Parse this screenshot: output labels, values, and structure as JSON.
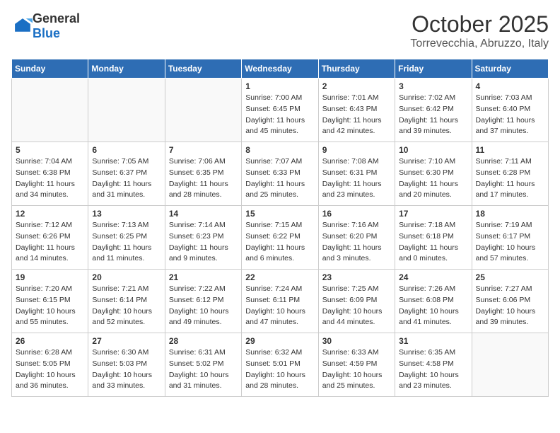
{
  "header": {
    "logo": {
      "general": "General",
      "blue": "Blue",
      "tagline": ""
    },
    "month": "October 2025",
    "location": "Torrevecchia, Abruzzo, Italy"
  },
  "days_of_week": [
    "Sunday",
    "Monday",
    "Tuesday",
    "Wednesday",
    "Thursday",
    "Friday",
    "Saturday"
  ],
  "weeks": [
    [
      {
        "day": "",
        "info": "",
        "empty": true
      },
      {
        "day": "",
        "info": "",
        "empty": true
      },
      {
        "day": "",
        "info": "",
        "empty": true
      },
      {
        "day": "1",
        "info": "Sunrise: 7:00 AM\nSunset: 6:45 PM\nDaylight: 11 hours\nand 45 minutes."
      },
      {
        "day": "2",
        "info": "Sunrise: 7:01 AM\nSunset: 6:43 PM\nDaylight: 11 hours\nand 42 minutes."
      },
      {
        "day": "3",
        "info": "Sunrise: 7:02 AM\nSunset: 6:42 PM\nDaylight: 11 hours\nand 39 minutes."
      },
      {
        "day": "4",
        "info": "Sunrise: 7:03 AM\nSunset: 6:40 PM\nDaylight: 11 hours\nand 37 minutes."
      }
    ],
    [
      {
        "day": "5",
        "info": "Sunrise: 7:04 AM\nSunset: 6:38 PM\nDaylight: 11 hours\nand 34 minutes."
      },
      {
        "day": "6",
        "info": "Sunrise: 7:05 AM\nSunset: 6:37 PM\nDaylight: 11 hours\nand 31 minutes."
      },
      {
        "day": "7",
        "info": "Sunrise: 7:06 AM\nSunset: 6:35 PM\nDaylight: 11 hours\nand 28 minutes."
      },
      {
        "day": "8",
        "info": "Sunrise: 7:07 AM\nSunset: 6:33 PM\nDaylight: 11 hours\nand 25 minutes."
      },
      {
        "day": "9",
        "info": "Sunrise: 7:08 AM\nSunset: 6:31 PM\nDaylight: 11 hours\nand 23 minutes."
      },
      {
        "day": "10",
        "info": "Sunrise: 7:10 AM\nSunset: 6:30 PM\nDaylight: 11 hours\nand 20 minutes."
      },
      {
        "day": "11",
        "info": "Sunrise: 7:11 AM\nSunset: 6:28 PM\nDaylight: 11 hours\nand 17 minutes."
      }
    ],
    [
      {
        "day": "12",
        "info": "Sunrise: 7:12 AM\nSunset: 6:26 PM\nDaylight: 11 hours\nand 14 minutes."
      },
      {
        "day": "13",
        "info": "Sunrise: 7:13 AM\nSunset: 6:25 PM\nDaylight: 11 hours\nand 11 minutes."
      },
      {
        "day": "14",
        "info": "Sunrise: 7:14 AM\nSunset: 6:23 PM\nDaylight: 11 hours\nand 9 minutes."
      },
      {
        "day": "15",
        "info": "Sunrise: 7:15 AM\nSunset: 6:22 PM\nDaylight: 11 hours\nand 6 minutes."
      },
      {
        "day": "16",
        "info": "Sunrise: 7:16 AM\nSunset: 6:20 PM\nDaylight: 11 hours\nand 3 minutes."
      },
      {
        "day": "17",
        "info": "Sunrise: 7:18 AM\nSunset: 6:18 PM\nDaylight: 11 hours\nand 0 minutes."
      },
      {
        "day": "18",
        "info": "Sunrise: 7:19 AM\nSunset: 6:17 PM\nDaylight: 10 hours\nand 57 minutes."
      }
    ],
    [
      {
        "day": "19",
        "info": "Sunrise: 7:20 AM\nSunset: 6:15 PM\nDaylight: 10 hours\nand 55 minutes."
      },
      {
        "day": "20",
        "info": "Sunrise: 7:21 AM\nSunset: 6:14 PM\nDaylight: 10 hours\nand 52 minutes."
      },
      {
        "day": "21",
        "info": "Sunrise: 7:22 AM\nSunset: 6:12 PM\nDaylight: 10 hours\nand 49 minutes."
      },
      {
        "day": "22",
        "info": "Sunrise: 7:24 AM\nSunset: 6:11 PM\nDaylight: 10 hours\nand 47 minutes."
      },
      {
        "day": "23",
        "info": "Sunrise: 7:25 AM\nSunset: 6:09 PM\nDaylight: 10 hours\nand 44 minutes."
      },
      {
        "day": "24",
        "info": "Sunrise: 7:26 AM\nSunset: 6:08 PM\nDaylight: 10 hours\nand 41 minutes."
      },
      {
        "day": "25",
        "info": "Sunrise: 7:27 AM\nSunset: 6:06 PM\nDaylight: 10 hours\nand 39 minutes."
      }
    ],
    [
      {
        "day": "26",
        "info": "Sunrise: 6:28 AM\nSunset: 5:05 PM\nDaylight: 10 hours\nand 36 minutes."
      },
      {
        "day": "27",
        "info": "Sunrise: 6:30 AM\nSunset: 5:03 PM\nDaylight: 10 hours\nand 33 minutes."
      },
      {
        "day": "28",
        "info": "Sunrise: 6:31 AM\nSunset: 5:02 PM\nDaylight: 10 hours\nand 31 minutes."
      },
      {
        "day": "29",
        "info": "Sunrise: 6:32 AM\nSunset: 5:01 PM\nDaylight: 10 hours\nand 28 minutes."
      },
      {
        "day": "30",
        "info": "Sunrise: 6:33 AM\nSunset: 4:59 PM\nDaylight: 10 hours\nand 25 minutes."
      },
      {
        "day": "31",
        "info": "Sunrise: 6:35 AM\nSunset: 4:58 PM\nDaylight: 10 hours\nand 23 minutes."
      },
      {
        "day": "",
        "info": "",
        "empty": true
      }
    ]
  ]
}
